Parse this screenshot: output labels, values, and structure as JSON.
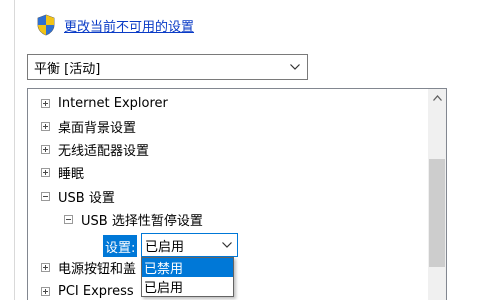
{
  "link": {
    "text": "更改当前不可用的设置",
    "icon": "uac-shield-icon"
  },
  "plan_select": {
    "value": "平衡 [活动]"
  },
  "tree": {
    "items": [
      {
        "label": "Internet Explorer",
        "expanded": false
      },
      {
        "label": "桌面背景设置",
        "expanded": false
      },
      {
        "label": "无线适配器设置",
        "expanded": false
      },
      {
        "label": "睡眠",
        "expanded": false
      },
      {
        "label": "USB 设置",
        "expanded": true
      },
      {
        "label": "USB 选择性暂停设置",
        "expanded": true
      },
      {
        "label": "电源按钮和盖",
        "expanded": false
      },
      {
        "label": "PCI Express",
        "expanded": false
      }
    ]
  },
  "setting": {
    "label": "设置:",
    "value": "已启用",
    "options": [
      "已禁用",
      "已启用"
    ],
    "highlighted_option": "已禁用"
  },
  "colors": {
    "link": "#0a3bc6",
    "selection": "#0078d7"
  }
}
